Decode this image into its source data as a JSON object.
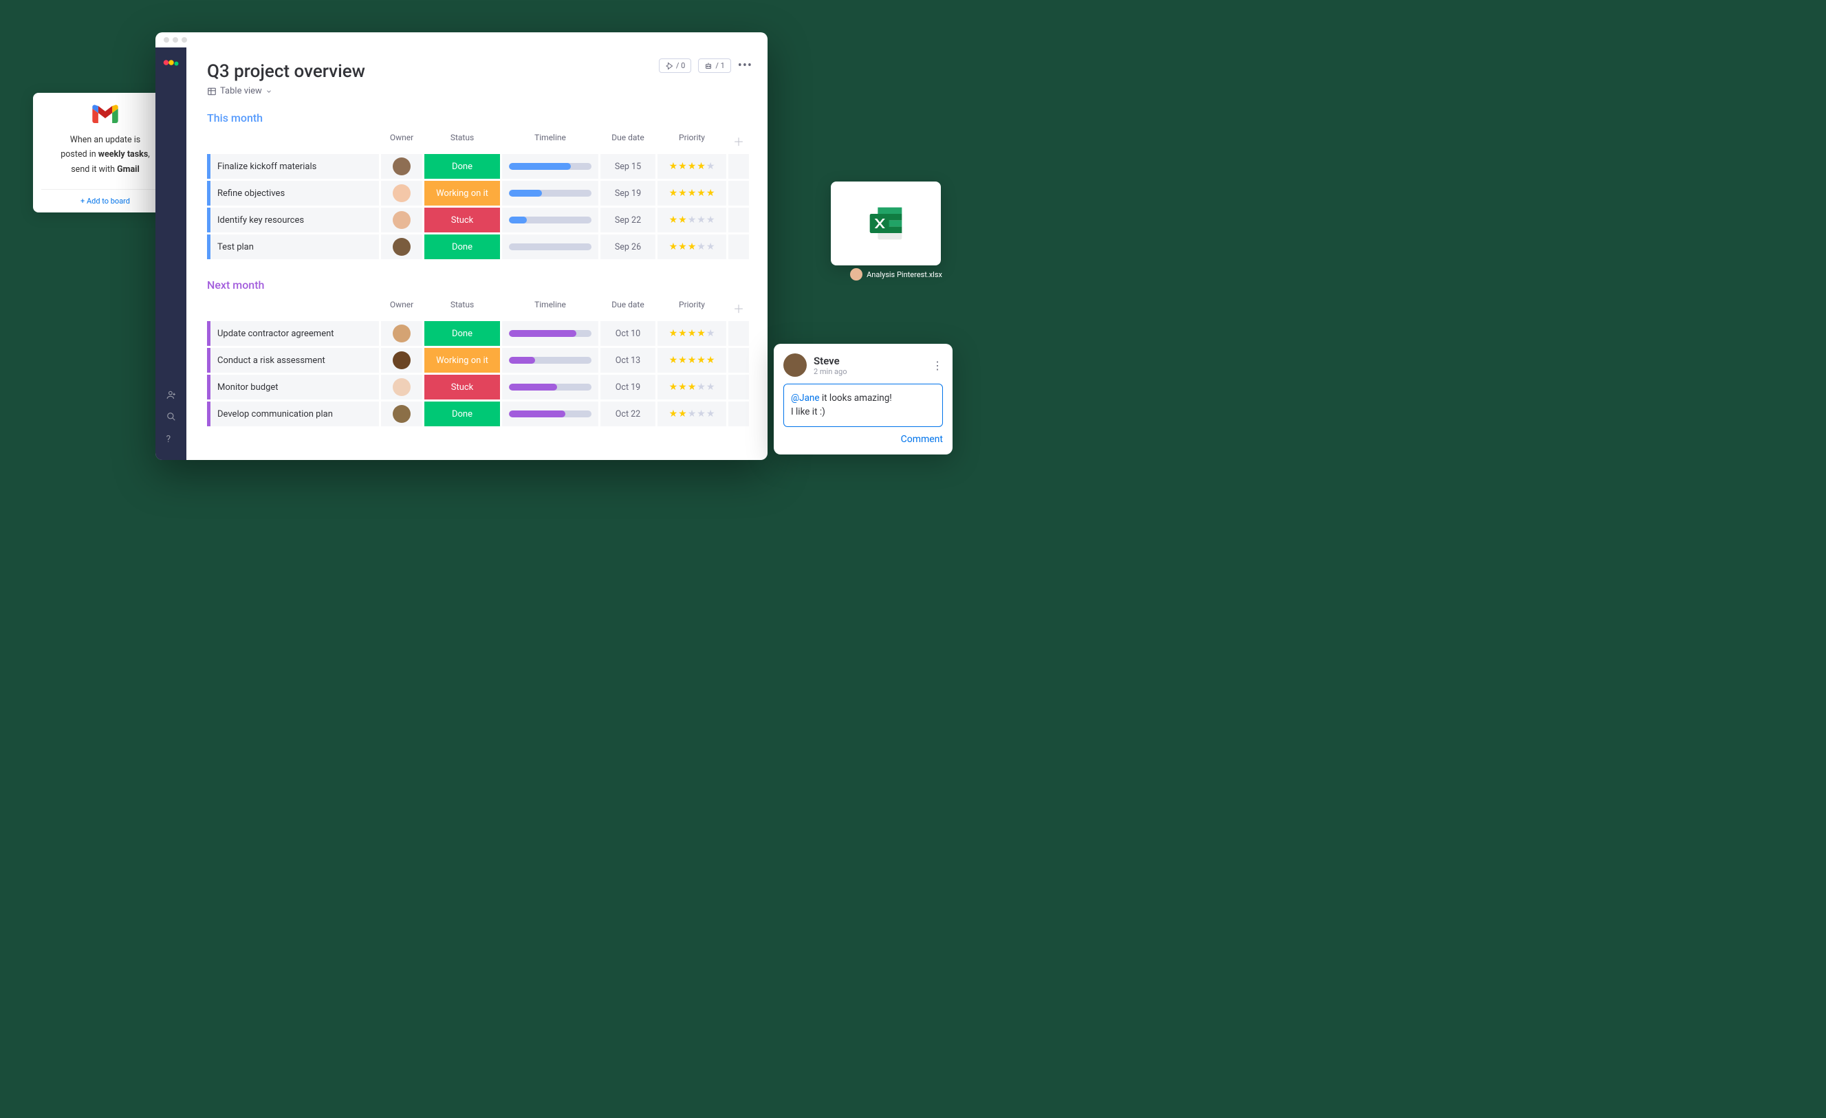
{
  "gmail": {
    "text_line1": "When an update is",
    "text_line2_pre": "posted in ",
    "text_line2_bold": "weekly tasks",
    "text_line2_post": ",",
    "text_line3_pre": "send it with ",
    "text_line3_bold": "Gmail",
    "add": "+ Add to board"
  },
  "page": {
    "title": "Q3 project overview",
    "view": "Table view",
    "integrations": "/ 0",
    "automations": "/ 1"
  },
  "columns": [
    "Owner",
    "Status",
    "Timeline",
    "Due date",
    "Priority"
  ],
  "groups": [
    {
      "title": "This month",
      "color": "blue",
      "rows": [
        {
          "task": "Finalize kickoff materials",
          "avatar": "a1",
          "status": "Done",
          "statusClass": "done",
          "progress": 75,
          "date": "Sep 15",
          "stars": 4
        },
        {
          "task": "Refine objectives",
          "avatar": "a2",
          "status": "Working on it",
          "statusClass": "working",
          "progress": 40,
          "date": "Sep 19",
          "stars": 5
        },
        {
          "task": "Identify key resources",
          "avatar": "a3",
          "status": "Stuck",
          "statusClass": "stuck",
          "progress": 22,
          "date": "Sep 22",
          "stars": 2
        },
        {
          "task": "Test plan",
          "avatar": "a4",
          "status": "Done",
          "statusClass": "done",
          "progress": 0,
          "date": "Sep 26",
          "stars": 3
        }
      ]
    },
    {
      "title": "Next month",
      "color": "purple",
      "rows": [
        {
          "task": "Update contractor agreement",
          "avatar": "a5",
          "status": "Done",
          "statusClass": "done",
          "progress": 82,
          "date": "Oct 10",
          "stars": 4
        },
        {
          "task": "Conduct a risk assessment",
          "avatar": "a6",
          "status": "Working on it",
          "statusClass": "working",
          "progress": 32,
          "date": "Oct 13",
          "stars": 5
        },
        {
          "task": "Monitor budget",
          "avatar": "a7",
          "status": "Stuck",
          "statusClass": "stuck",
          "progress": 58,
          "date": "Oct 19",
          "stars": 3
        },
        {
          "task": "Develop communication plan",
          "avatar": "a8",
          "status": "Done",
          "statusClass": "done",
          "progress": 68,
          "date": "Oct 22",
          "stars": 2
        }
      ]
    }
  ],
  "excel": {
    "filename": "Analysis Pinterest.xlsx"
  },
  "comment": {
    "name": "Steve",
    "time": "2 min ago",
    "mention": "@Jane",
    "line1_rest": " it looks amazing!",
    "line2": "I like it :)",
    "action": "Comment"
  }
}
